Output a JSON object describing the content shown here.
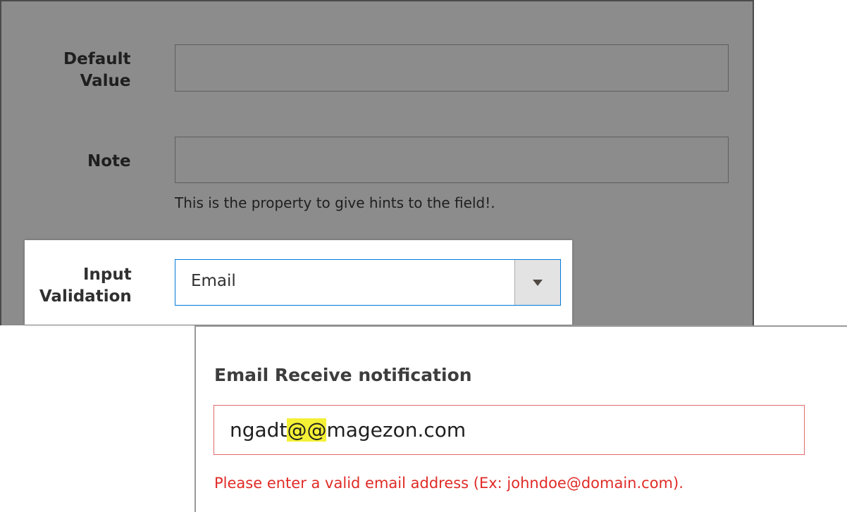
{
  "form": {
    "default_value": {
      "label_line1": "Default",
      "label_line2": "Value",
      "value": ""
    },
    "note": {
      "label": "Note",
      "value": "",
      "hint": "This is the property to give hints to the field!."
    },
    "input_validation": {
      "label_line1": "Input",
      "label_line2": "Validation",
      "selected": "Email"
    }
  },
  "frontend": {
    "field_label": "Email Receive notification",
    "input_prefix": "ngadt",
    "input_highlight": "@@",
    "input_suffix": "magezon.com",
    "error_message": "Please enter a valid email address (Ex: johndoe@domain.com)."
  },
  "colors": {
    "panel_gray": "#8c8c8c",
    "focus_blue": "#007bdb",
    "error_red": "#e02b27",
    "error_border": "#e26a6a",
    "highlight_yellow": "#f4f036"
  },
  "icons": {
    "select_toggle": "triangle-down-icon"
  }
}
